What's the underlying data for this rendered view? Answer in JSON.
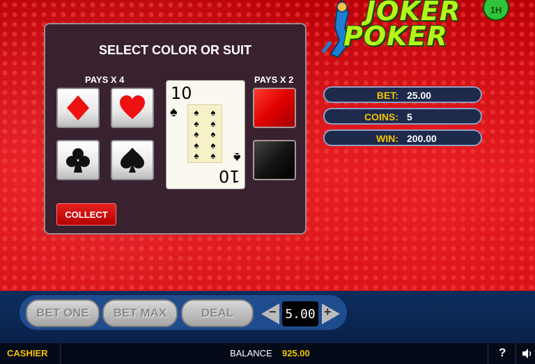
{
  "logo": {
    "word1": "JOKER",
    "word2": "POKER",
    "badge": "1H"
  },
  "panel": {
    "title": "SELECT COLOR OR SUIT",
    "pays_suit": "PAYS X 4",
    "pays_color": "PAYS X 2",
    "collect_label": "COLLECT"
  },
  "card": {
    "rank": "10",
    "suit": "♠"
  },
  "info": {
    "bet_label": "BET:",
    "bet_value": "25.00",
    "coins_label": "COINS:",
    "coins_value": "5",
    "win_label": "WIN:",
    "win_value": "200.00"
  },
  "controls": {
    "bet_one": "BET ONE",
    "bet_max": "BET MAX",
    "deal": "DEAL",
    "minus": "−",
    "plus": "+",
    "coin_value": "5.00"
  },
  "status": {
    "cashier": "CASHIER",
    "balance_label": "BALANCE",
    "balance_value": "925.00",
    "help": "?",
    "sound_icon": "speaker-icon"
  },
  "colors": {
    "accent_yellow": "#f5c400",
    "bg_red": "#c9050a",
    "bar_navy": "#0d2d5e",
    "logo_green": "#b6f51a"
  }
}
